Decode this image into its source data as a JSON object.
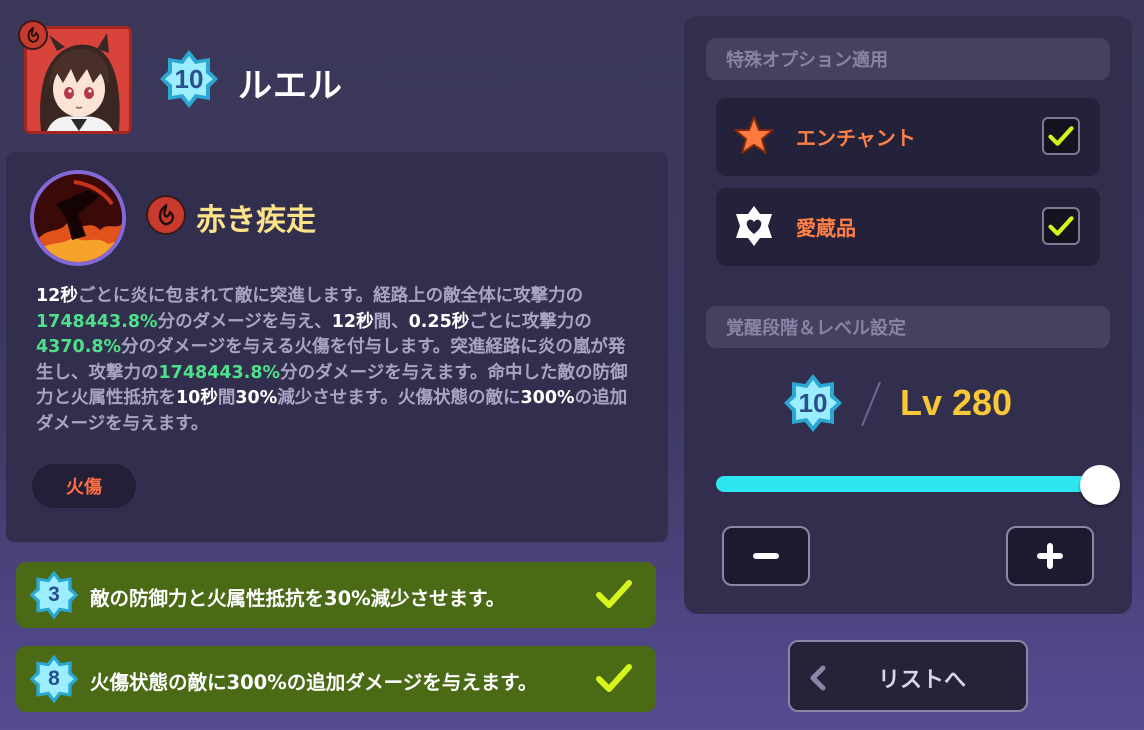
{
  "character": {
    "name": "ルエル",
    "awakening_stage": "10",
    "element": "fire"
  },
  "skill": {
    "name": "赤き疾走",
    "element": "fire",
    "description_segments": [
      {
        "t": "12秒",
        "s": "w"
      },
      {
        "t": "ごとに炎に包まれて敵に突進します。経路上の敵全体に攻撃力の",
        "s": "n"
      },
      {
        "t": "1748443.8%",
        "s": "g"
      },
      {
        "t": "分のダメージを与え、",
        "s": "n"
      },
      {
        "t": "12秒",
        "s": "w"
      },
      {
        "t": "間、",
        "s": "n"
      },
      {
        "t": "0.25秒",
        "s": "w"
      },
      {
        "t": "ごとに攻撃力の",
        "s": "n"
      },
      {
        "t": "4370.8%",
        "s": "g"
      },
      {
        "t": "分のダメージを与える火傷を付与します。突進経路に炎の嵐が発生し、攻撃力の",
        "s": "n"
      },
      {
        "t": "1748443.8%",
        "s": "g"
      },
      {
        "t": "分のダメージを与えます。命中した敵の防御力と火属性抵抗を",
        "s": "n"
      },
      {
        "t": "10秒",
        "s": "w"
      },
      {
        "t": "間",
        "s": "n"
      },
      {
        "t": "30%",
        "s": "w"
      },
      {
        "t": "減少させます。火傷状態の敵に",
        "s": "n"
      },
      {
        "t": "300%",
        "s": "w"
      },
      {
        "t": "の追加ダメージを与えます。",
        "s": "n"
      }
    ],
    "tag": "火傷"
  },
  "effects": [
    {
      "stage": "3",
      "text": "敵の防御力と火属性抵抗を30%減少させます。",
      "checked": true
    },
    {
      "stage": "8",
      "text": "火傷状態の敵に300%の追加ダメージを与えます。",
      "checked": true
    }
  ],
  "special_options": {
    "header": "特殊オプション適用",
    "items": [
      {
        "label": "エンチャント",
        "icon": "enchant-star-icon",
        "checked": true
      },
      {
        "label": "愛蔵品",
        "icon": "heart-badge-icon",
        "checked": true
      }
    ]
  },
  "level_settings": {
    "header": "覚醒段階＆レベル設定",
    "awakening_stage": "10",
    "level_text": "Lv 280",
    "slider_fraction": 1.0
  },
  "buttons": {
    "minus": "−",
    "plus": "+",
    "back_to_list": "リストへ"
  },
  "colors": {
    "accent_cyan": "#2ee6ef",
    "level_gold": "#f9c935",
    "skill_gold": "#fce289",
    "highlight_green": "#4fe08a",
    "option_orange": "#ff8045",
    "effect_green": "#4a6a16",
    "check_lime": "#d6f51d"
  }
}
